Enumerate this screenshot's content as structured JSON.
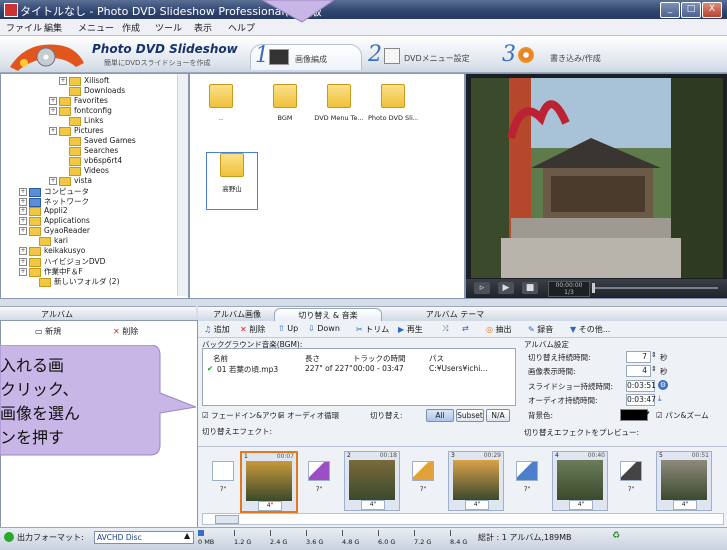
{
  "window": {
    "title": "タイトルなし - Photo DVD Slideshow Professional(体験版",
    "min": "_",
    "max": "□",
    "close": "X"
  },
  "menu": [
    "ファイル",
    "編集",
    "メニュー",
    "作成",
    "ツール",
    "表示",
    "ヘルプ"
  ],
  "header": {
    "app_title": "Photo DVD Slideshow",
    "subtitle": "簡単にDVDスライドショーを作成",
    "steps": [
      {
        "num": "1",
        "label": "画像編成"
      },
      {
        "num": "2",
        "label": "DVDメニュー設定"
      },
      {
        "num": "3",
        "label": "書き込み/作成"
      }
    ]
  },
  "tree": [
    {
      "label": "Xilisoft",
      "indent": 5,
      "exp": "+"
    },
    {
      "label": "Downloads",
      "indent": 5,
      "exp": ""
    },
    {
      "label": "Favorites",
      "indent": 4,
      "exp": "+"
    },
    {
      "label": "fontconfig",
      "indent": 4,
      "exp": "+"
    },
    {
      "label": "Links",
      "indent": 5,
      "exp": ""
    },
    {
      "label": "Pictures",
      "indent": 4,
      "exp": "+"
    },
    {
      "label": "Saved Games",
      "indent": 5,
      "exp": ""
    },
    {
      "label": "Searches",
      "indent": 5,
      "exp": ""
    },
    {
      "label": "vb6sp6rt4",
      "indent": 5,
      "exp": ""
    },
    {
      "label": "Videos",
      "indent": 5,
      "exp": ""
    },
    {
      "label": "vista",
      "indent": 4,
      "exp": "+"
    },
    {
      "label": "コンピュータ",
      "indent": 1,
      "exp": "+",
      "pc": true
    },
    {
      "label": "ネットワーク",
      "indent": 1,
      "exp": "+",
      "pc": true
    },
    {
      "label": "Appli2",
      "indent": 1,
      "exp": "+"
    },
    {
      "label": "Applications",
      "indent": 1,
      "exp": "+"
    },
    {
      "label": "GyaoReader",
      "indent": 1,
      "exp": "+"
    },
    {
      "label": "kari",
      "indent": 2,
      "exp": ""
    },
    {
      "label": "keikakusyo",
      "indent": 1,
      "exp": "+"
    },
    {
      "label": "ハイビジョンDVD",
      "indent": 1,
      "exp": "+"
    },
    {
      "label": "作業中F＆F",
      "indent": 1,
      "exp": "+"
    },
    {
      "label": "新しいフォルダ (2)",
      "indent": 2,
      "exp": ""
    }
  ],
  "files": [
    {
      "name": ".."
    },
    {
      "name": "BGM"
    },
    {
      "name": "DVD Menu Te..."
    },
    {
      "name": "Photo DVD Sli..."
    },
    {
      "name": "高野山"
    }
  ],
  "player": {
    "time": "00:00:00",
    "frame": "1/3"
  },
  "left_tab": "アルバム",
  "album_toolbar": {
    "new": "新規",
    "delete": "削除"
  },
  "mid_tabs": [
    "アルバム画像",
    "切り替え & 音楽",
    "アルバム テーマ"
  ],
  "toolbar": {
    "add": "追加",
    "delete": "削除",
    "up": "Up",
    "down": "Down",
    "trim": "トリム",
    "play": "再生",
    "extract": "抽出",
    "record": "録音",
    "more": "その他..."
  },
  "bgm": {
    "heading": "バックグラウンド音楽(BGM):",
    "columns": [
      "名前",
      "長さ",
      "トラックの時間",
      "パス"
    ],
    "rows": [
      {
        "name": "01 若葉の頃.mp3",
        "length": "227\" of 227\"",
        "track_time": "00:00 - 03:47",
        "path": "C:¥Users¥ichi..."
      }
    ],
    "fade": "フェードイン&アウト",
    "loop": "オーディオ循環",
    "switch_label": "切り替え:",
    "switch_buttons": [
      "All",
      "Subset",
      "N/A"
    ],
    "effects_label": "切り替えエフェクト:"
  },
  "album_settings": {
    "heading": "アルバム設定",
    "switch_duration_label": "切り替え持続時間:",
    "switch_duration": "7",
    "image_duration_label": "画像表示時間:",
    "image_duration": "4",
    "unit": "秒",
    "slideshow_duration_label": "スライドショー持続時間:",
    "slideshow_duration": "0:03:51",
    "audio_duration_label": "オーディオ持続時間:",
    "audio_duration": "0:03:47",
    "bg_label": "背景色:",
    "panzoom": "パン&ズーム",
    "preview_label": "切り替えエフェクトをプレビュー:"
  },
  "timeline": [
    {
      "idx": "1",
      "time": "00:07",
      "dur": "4\"",
      "tdur": "7\""
    },
    {
      "idx": "2",
      "time": "00:18",
      "dur": "4\"",
      "tdur": "7\""
    },
    {
      "idx": "3",
      "time": "00:29",
      "dur": "4\"",
      "tdur": "7\""
    },
    {
      "idx": "4",
      "time": "00:40",
      "dur": "4\"",
      "tdur": "7\""
    },
    {
      "idx": "5",
      "time": "00:51",
      "dur": "4\"",
      "tdur": ""
    }
  ],
  "timeline_first_trans": "7\"",
  "status": {
    "output_label": "出力フォーマット:",
    "format": "AVCHD Disc",
    "scale": [
      "0 MB",
      "1.2 G",
      "2.4 G",
      "3.6 G",
      "4.8 G",
      "6.0 G",
      "7.2 G",
      "8.4 G"
    ],
    "total": "総計 : 1 アルバム,189MB"
  },
  "callout": {
    "lines": [
      "入れる画",
      "クリック、",
      "画像を選ん",
      "ンを押す"
    ]
  },
  "colors": {
    "accent": "#3a6fc4",
    "callout": "#c8b6e6",
    "titlebar": "#2f4470"
  }
}
